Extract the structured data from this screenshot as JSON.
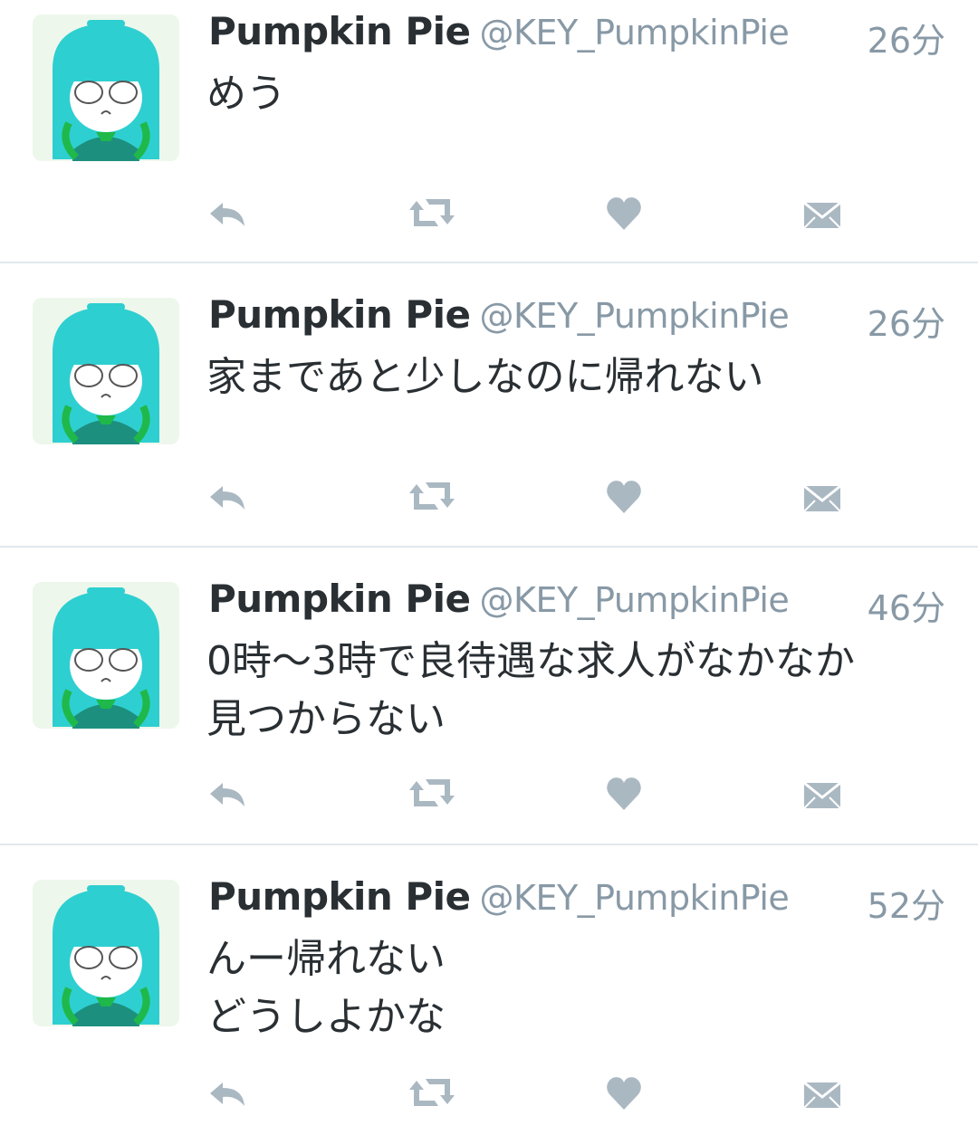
{
  "tweets": [
    {
      "name": "Pumpkin Pie",
      "handle": "@KEY_PumpkinPie",
      "time": "26分",
      "lines": [
        "めう"
      ]
    },
    {
      "name": "Pumpkin Pie",
      "handle": "@KEY_PumpkinPie",
      "time": "26分",
      "lines": [
        "家まであと少しなのに帰れない"
      ]
    },
    {
      "name": "Pumpkin Pie",
      "handle": "@KEY_PumpkinPie",
      "time": "46分",
      "lines": [
        "0時〜3時で良待遇な求人がなかなか",
        "見つからない"
      ]
    },
    {
      "name": "Pumpkin Pie",
      "handle": "@KEY_PumpkinPie",
      "time": "52分",
      "lines": [
        "んー帰れない",
        "どうしよかな"
      ]
    }
  ],
  "icons": {
    "reply": "reply-icon",
    "retweet": "retweet-icon",
    "like": "heart-icon",
    "dm": "envelope-icon",
    "avatar": "avatar-anime-girl"
  },
  "colors": {
    "text": "#292f33",
    "muted": "#8899a6",
    "icon": "#aab8c2",
    "divider": "#e1e8ed",
    "avatar_hair": "#2ecfd0",
    "avatar_accent": "#1fb84a"
  }
}
